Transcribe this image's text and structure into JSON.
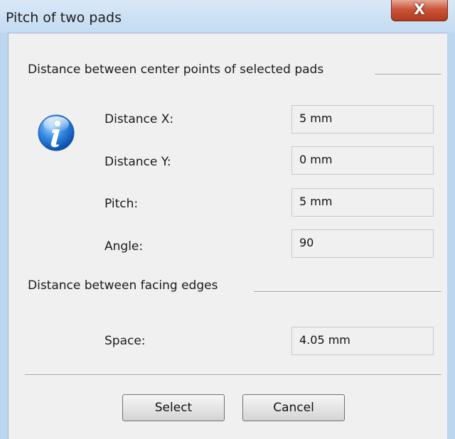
{
  "window": {
    "title": "Pitch of two pads",
    "close_label": "X"
  },
  "section_center": {
    "label": "Distance between center points of selected pads"
  },
  "fields": {
    "distance_x": {
      "label": "Distance X:",
      "value": "5 mm"
    },
    "distance_y": {
      "label": "Distance Y:",
      "value": "0 mm"
    },
    "pitch": {
      "label": "Pitch:",
      "value": "5 mm"
    },
    "angle": {
      "label": "Angle:",
      "value": "90"
    },
    "space": {
      "label": "Space:",
      "value": "4.05 mm"
    }
  },
  "section_edges": {
    "label": "Distance between facing edges"
  },
  "buttons": {
    "select": "Select",
    "cancel": "Cancel"
  },
  "icons": {
    "info": "info-icon",
    "close": "close-icon"
  }
}
